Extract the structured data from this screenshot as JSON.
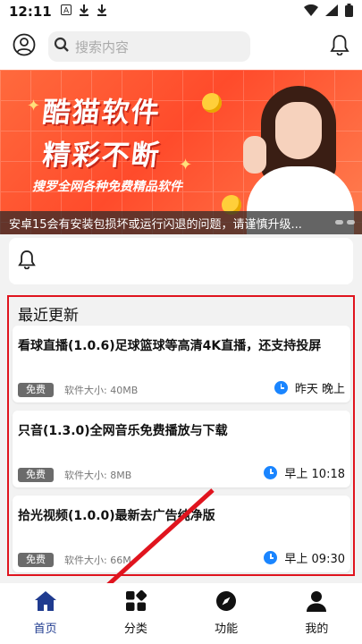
{
  "status_bar": {
    "time": "12:11"
  },
  "search": {
    "placeholder": "搜索内容"
  },
  "banner": {
    "headline_1": "酷猫软件",
    "headline_2": "精彩不断",
    "subtitle": "搜罗全网各种免费精品软件",
    "notice": "安卓15会有安装包损坏或运行闪退的问题，请谨慎升级..."
  },
  "recent": {
    "title": "最近更新",
    "items": [
      {
        "title": "看球直播(1.0.6)足球篮球等高清4K直播，还支持投屏",
        "badge": "免费",
        "size": "软件大小: 40MB",
        "time": "昨天 晚上"
      },
      {
        "title": "只音(1.3.0)全网音乐免费播放与下载",
        "badge": "免费",
        "size": "软件大小: 8MB",
        "time": "早上 10:18"
      },
      {
        "title": "拾光视频(1.0.0)最新去广告纯净版",
        "badge": "免费",
        "size": "软件大小: 66M",
        "time": "早上 09:30"
      }
    ]
  },
  "tabs": [
    {
      "label": "首页",
      "icon": "home-icon"
    },
    {
      "label": "分类",
      "icon": "grid-icon"
    },
    {
      "label": "功能",
      "icon": "compass-icon"
    },
    {
      "label": "我的",
      "icon": "user-icon"
    }
  ],
  "colors": {
    "accent": "#1f3b8f",
    "highlight": "#e0141e",
    "clock": "#1a85ff",
    "banner": "#ff4b2b"
  }
}
